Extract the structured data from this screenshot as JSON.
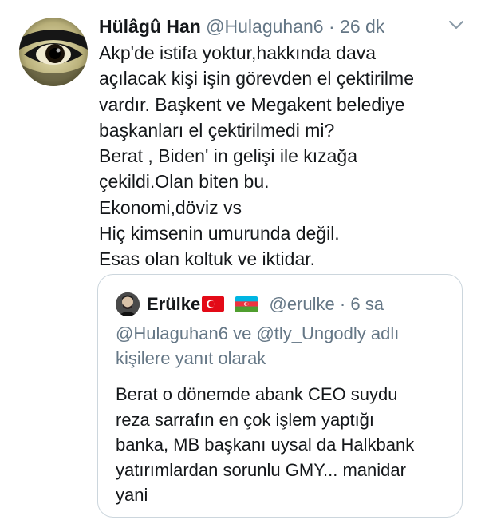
{
  "tweet": {
    "display_name": "Hülâgû Han",
    "handle": "@Hulaguhan6",
    "separator": "·",
    "time": "26 dk",
    "lines": [
      "Akp'de istifa yoktur,hakkında dava",
      "açılacak kişi işin görevden el çektirilme",
      "vardır. Başkent ve Megakent belediye",
      "başkanları el çektirilmedi mi?",
      "Berat , Biden' in gelişi ile kızağa",
      "çekildi.Olan biten bu.",
      "Ekonomi,döviz vs",
      "Hiç kimsenin umurunda değil.",
      "Esas olan koltuk ve iktidar."
    ],
    "avatar_icon": "eye-avatar",
    "menu_icon": "chevron-down-icon"
  },
  "quoted_tweet": {
    "display_name": "Erülke",
    "flags": [
      "turkey-flag-icon",
      "azerbaijan-flag-icon"
    ],
    "handle": "@erulke",
    "separator": "·",
    "time": "6 sa",
    "reply_context": [
      "@Hulaguhan6 ve @tly_Ungodly adlı",
      "kişilere yanıt olarak"
    ],
    "lines": [
      "Berat o dönemde abank CEO suydu",
      "reza sarrafın en çok işlem yaptığı",
      "banka, MB başkanı uysal da Halkbank",
      "yatırımlardan sorunlu GMY... manidar",
      "yani"
    ]
  },
  "colors": {
    "text_primary": "#14171a",
    "text_secondary": "#657786",
    "border": "#ccd6dd",
    "background": "#ffffff"
  }
}
